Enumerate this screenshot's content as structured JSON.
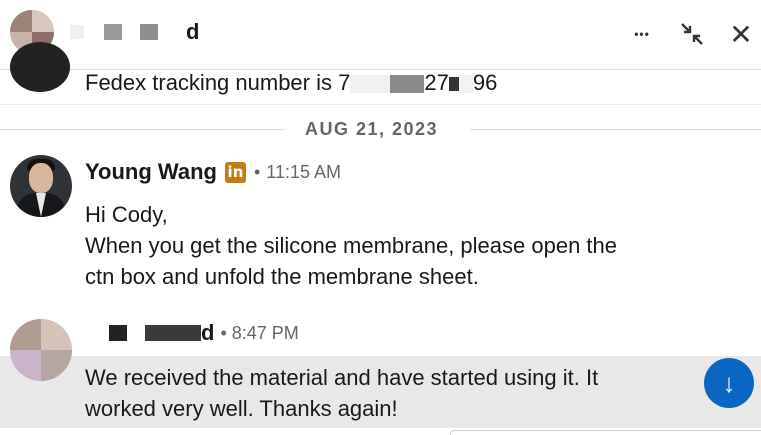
{
  "header": {
    "name_suffix": "d",
    "more_label": "•••",
    "collapse_icon": "collapse-icon",
    "close_label": "✕"
  },
  "previous_message": {
    "text_before": "Fedex tracking number is 7",
    "text_middle": "27",
    "text_end": "96"
  },
  "date_separator": "AUG 21, 2023",
  "messages": [
    {
      "sender": "Young Wang",
      "badge": "in",
      "dot": "•",
      "time": "11:15 AM",
      "lines": [
        "Hi Cody,",
        "When you get the silicone membrane, please open the",
        "ctn box and unfold the membrane sheet."
      ]
    },
    {
      "sender_suffix": "d",
      "dot": "•",
      "time": "8:47 PM",
      "lines": [
        "We received the material and have started using it.  It",
        "worked very well.  Thanks again!"
      ]
    }
  ],
  "scroll_button_label": "↓",
  "colors": {
    "accent": "#0a66c2",
    "linkedin_badge": "#c37d16",
    "highlight": "#e8e8e8",
    "muted_text": "#666666"
  }
}
